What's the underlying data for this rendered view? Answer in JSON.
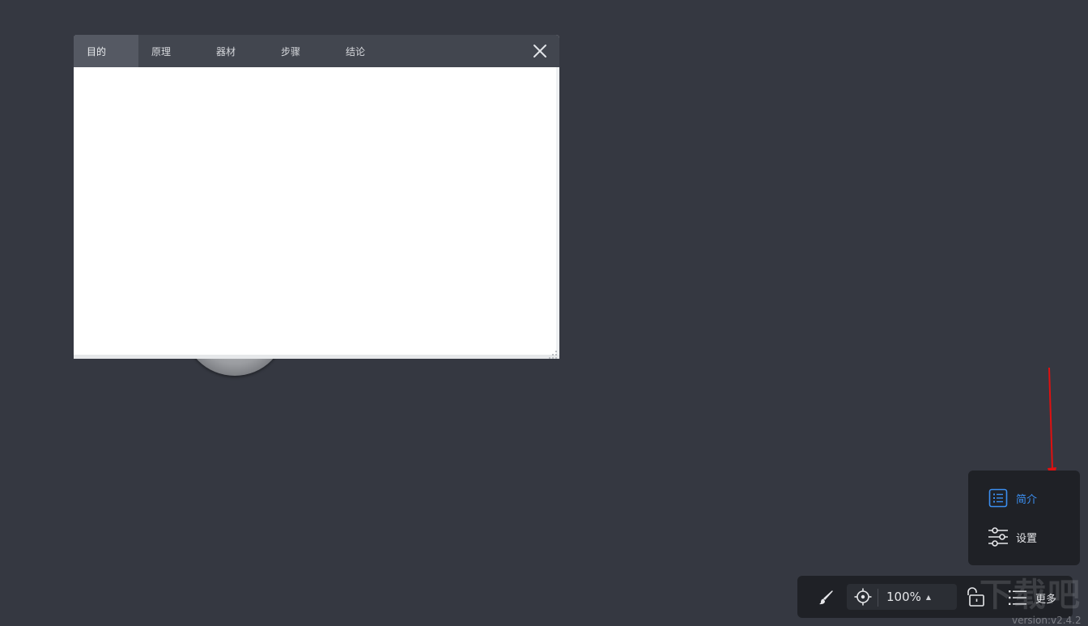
{
  "panel": {
    "tabs": [
      {
        "label": "目的",
        "active": true
      },
      {
        "label": "原理",
        "active": false
      },
      {
        "label": "器材",
        "active": false
      },
      {
        "label": "步骤",
        "active": false
      },
      {
        "label": "结论",
        "active": false
      }
    ],
    "close_icon": "close-icon"
  },
  "popup_menu": {
    "items": [
      {
        "label": "简介",
        "icon": "list-doc-icon",
        "color": "#3b8ef0"
      },
      {
        "label": "设置",
        "icon": "sliders-icon",
        "color": "#e6e7ea"
      }
    ]
  },
  "toolbar": {
    "brush_icon": "brush-icon",
    "locate_icon": "crosshair-icon",
    "zoom_value": "100%",
    "zoom_caret": "▲",
    "lock_icon": "unlock-icon",
    "more_icon": "menu-icon",
    "more_label": "更多"
  },
  "watermark": {
    "logo_text": "下载吧",
    "version": "version:v2.4.2"
  },
  "colors": {
    "background": "#353841",
    "panel_header": "#42464f",
    "menu_bg": "#1f2126",
    "accent": "#3b8ef0",
    "annotation_arrow": "#e01010"
  }
}
